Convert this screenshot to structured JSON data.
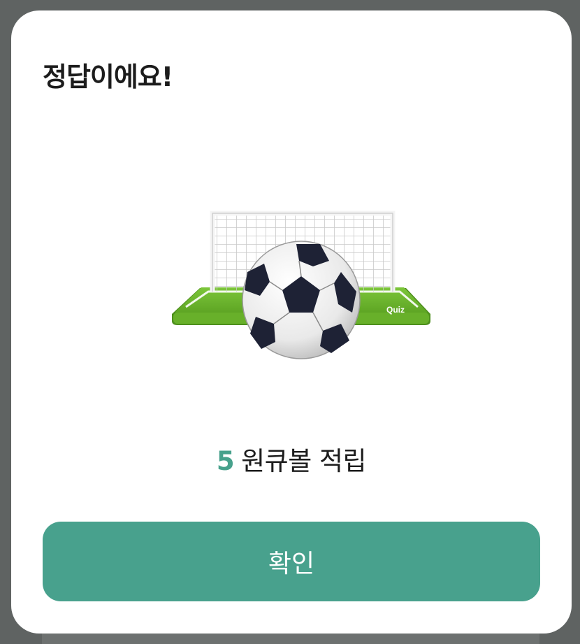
{
  "dialog": {
    "title": "정답이에요!",
    "illustration": {
      "goal_label": "Quiz",
      "icon": "soccer-goal-ball-icon"
    },
    "reward": {
      "amount": "5",
      "text": "원큐볼 적립"
    },
    "confirm_label": "확인"
  },
  "colors": {
    "overlay": "#5f6362",
    "accent": "#48a18d",
    "title_text": "#1c1c1c",
    "field_green": "#6ab42c"
  }
}
